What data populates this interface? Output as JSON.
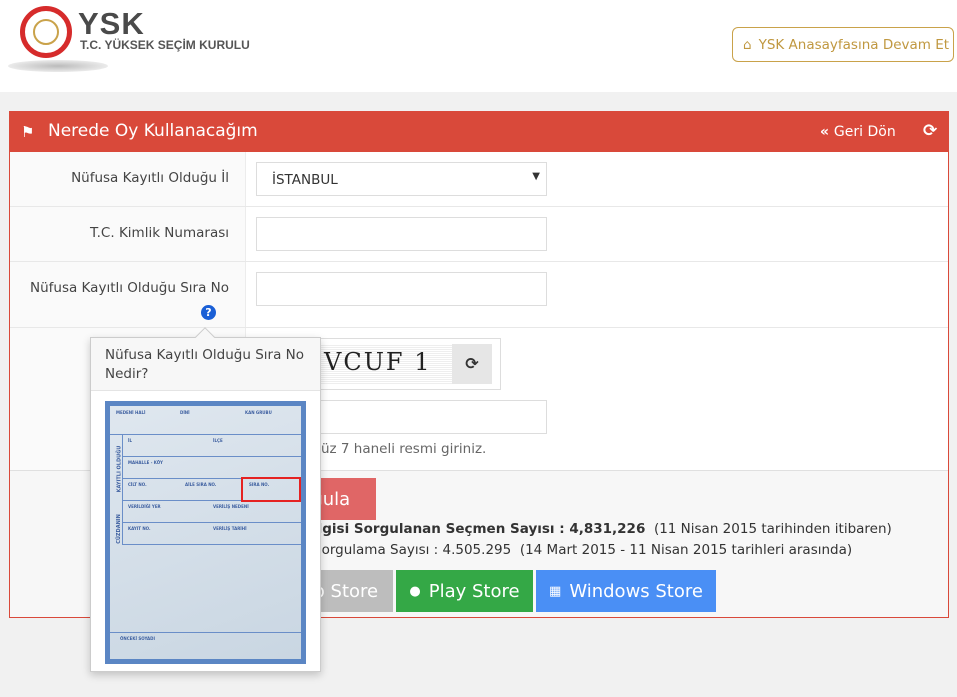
{
  "header": {
    "logo_title": "YSK",
    "logo_subtitle": "T.C. YÜKSEK SEÇİM KURULU",
    "home_button": "YSK Anasayfasına Devam Et",
    "home_icon": "home-icon"
  },
  "panel": {
    "title": "Nerede Oy Kullanacağım",
    "title_icon": "flag-icon",
    "back_label": "Geri Dön",
    "accent": "#d9493a"
  },
  "form": {
    "province_label": "Nüfusa Kayıtlı Olduğu İl",
    "province_value": "İSTANBUL",
    "tc_label": "T.C. Kimlik Numarası",
    "tc_value": "",
    "sira_label": "Nüfusa Kayıtlı Olduğu Sıra No",
    "sira_value": "",
    "captcha_text": "VCUF 1",
    "captcha_value": "",
    "captcha_help": "gördüğünüz 7 haneli resmi giriniz."
  },
  "actions": {
    "query_button": "Sorgula"
  },
  "stats": {
    "line1_label": "ilgisi Sorgulanan Seçmen Sayısı : 4,831,226",
    "line1_note": "(11 Nisan 2015 tarihinden itibaren)",
    "line2_label": "Sorgulama Sayısı : 4.505.295",
    "line2_note": "(14 Mart 2015 - 11 Nisan 2015 tarihleri arasında)"
  },
  "stores": {
    "app_store": "App Store",
    "play_store": "Play Store",
    "windows_store": "Windows Store",
    "app_color": "#bdbdbd",
    "play_color": "#34a846",
    "windows_color": "#4a8ff5"
  },
  "popover": {
    "title": "Nüfusa Kayıtlı Olduğu Sıra No Nedir?",
    "card_labels": {
      "medeni": "MEDENİ HALİ",
      "dini": "DİNİ",
      "kan": "KAN GRUBU",
      "il": "İL",
      "ilce": "İLÇE",
      "mahalle": "MAHALLE - KÖY",
      "cilt": "CİLT NO.",
      "aile": "AİLE SIRA NO.",
      "sira": "SIRA NO.",
      "verildigi": "VERİLDİĞİ YER",
      "nedeni": "VERİLİŞ NEDENİ",
      "kayit": "KAYIT NO.",
      "tarihi": "VERİLİŞ TARİHİ",
      "onceki": "ÖNCEKİ SOYADI",
      "side1": "KAYITLI OLDUĞU",
      "side2": "CÜZDANIN"
    }
  }
}
